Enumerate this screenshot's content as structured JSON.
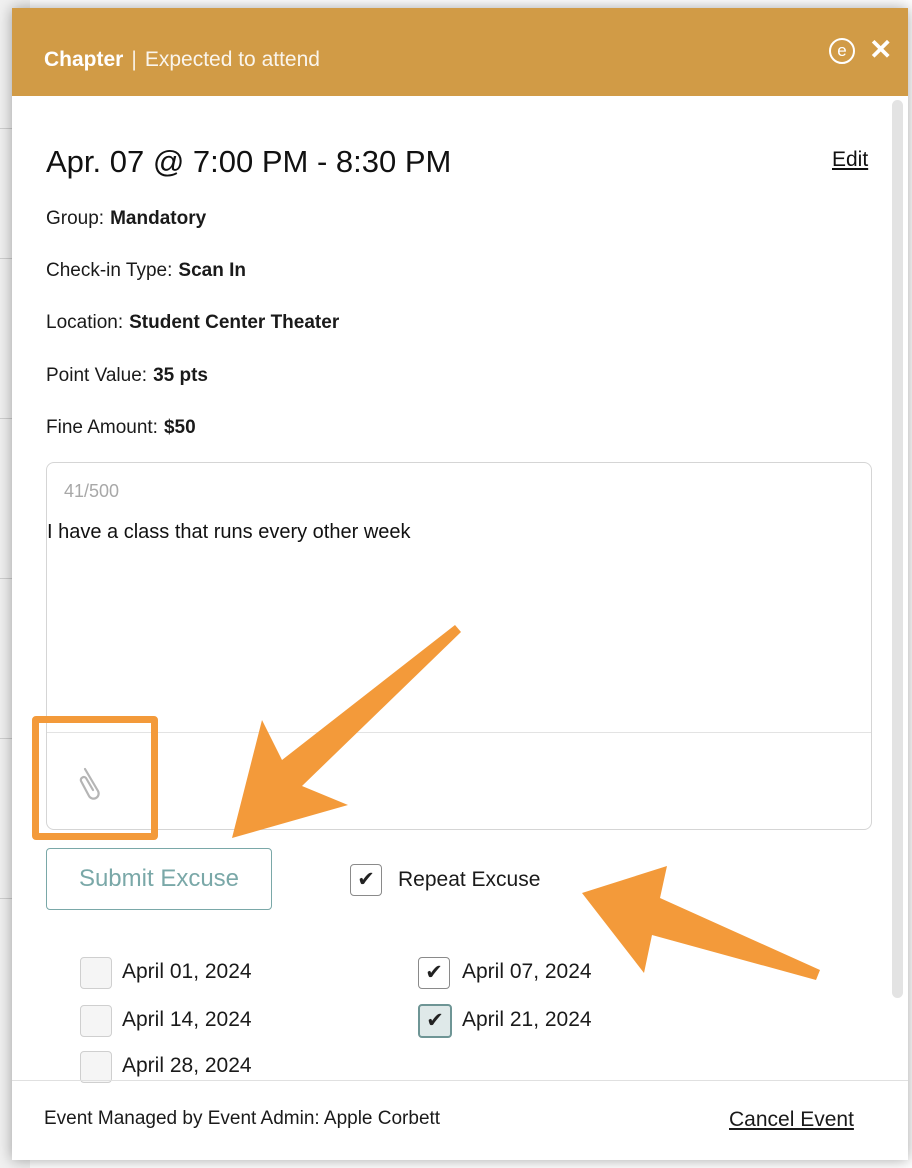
{
  "header": {
    "category": "Chapter",
    "separator": "|",
    "subtitle": "Expected to attend",
    "logo_glyph": "e",
    "close_glyph": "✕",
    "color": "#d19b46"
  },
  "event": {
    "title": "Apr. 07 @ 7:00 PM - 8:30 PM",
    "edit_label": "Edit",
    "details": {
      "group_label": "Group:",
      "group_value": "Mandatory",
      "checkin_label": "Check-in Type:",
      "checkin_value": "Scan In",
      "location_label": "Location:",
      "location_value": "Student Center Theater",
      "points_label": "Point Value:",
      "points_value": "35 pts",
      "fine_label": "Fine Amount:",
      "fine_value": "$50"
    }
  },
  "excuse": {
    "counter": "41/500",
    "text": "I have a class that runs every other week",
    "attach_icon": "paperclip-icon",
    "submit_label": "Submit Excuse",
    "repeat_label": "Repeat Excuse",
    "repeat_checked": true
  },
  "dates": [
    {
      "label": "April 01, 2024",
      "checked": false
    },
    {
      "label": "April 07, 2024",
      "checked": true
    },
    {
      "label": "April 14, 2024",
      "checked": false
    },
    {
      "label": "April 21, 2024",
      "checked": true
    },
    {
      "label": "April 28, 2024",
      "checked": false
    }
  ],
  "footer": {
    "managed_by": "Event Managed by Event Admin: Apple Corbett",
    "cancel_label": "Cancel Event"
  },
  "annotation_color": "#f39a3a",
  "accent": "#7aa8a8"
}
